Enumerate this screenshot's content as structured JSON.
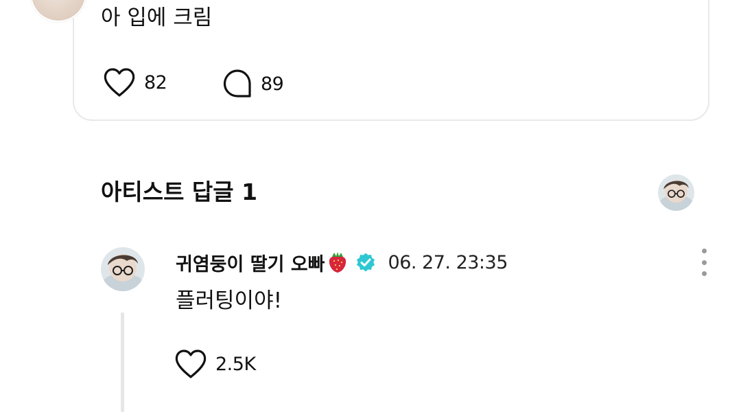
{
  "post": {
    "text": "아 입에 크림",
    "likes": "82",
    "comments": "89"
  },
  "artist_replies": {
    "title": "아티스트 답글 1"
  },
  "reply": {
    "author": "귀염둥이 딸기 오빠",
    "emoji": "strawberry-icon",
    "verified_icon": "verified-badge-icon",
    "timestamp": "06. 27. 23:35",
    "text": "플러팅이야!",
    "likes": "2.5K"
  },
  "colors": {
    "verified": "#2ec8d2",
    "divider": "#e8e8e8",
    "text": "#111111",
    "muted_dots": "#9a9a9a"
  }
}
